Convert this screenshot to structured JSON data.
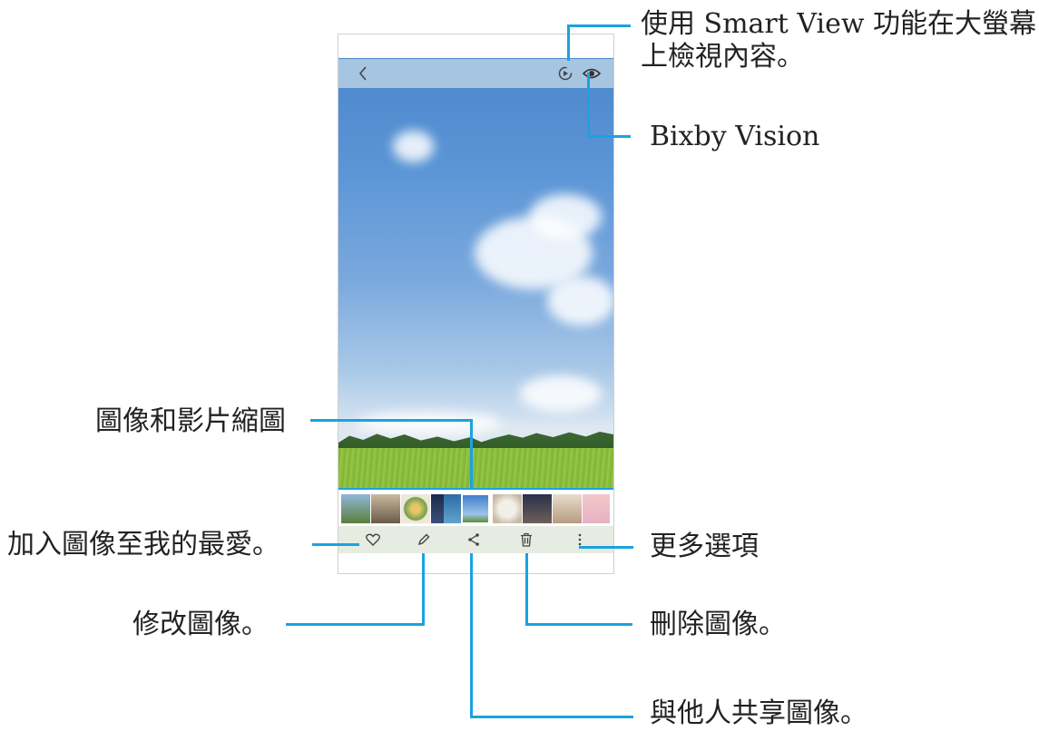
{
  "callouts": {
    "smart_view_line1": "使用 Smart View 功能在大螢幕",
    "smart_view_line2": "上檢視內容。",
    "bixby": "Bixby Vision",
    "thumbnails": "圖像和影片縮圖",
    "favorite": "加入圖像至我的最愛。",
    "more": "更多選項",
    "edit": "修改圖像。",
    "delete": "刪除圖像。",
    "share": "與他人共享圖像。"
  },
  "icons": {
    "back": "chevron-left-icon",
    "smart_view": "smart-view-icon",
    "bixby": "eye-icon",
    "favorite": "heart-icon",
    "edit": "pencil-icon",
    "share": "share-icon",
    "delete": "trash-icon",
    "more": "more-vertical-icon"
  },
  "colors": {
    "callout_line": "#1aa3df",
    "toolbar_bg": "#e7ece2"
  }
}
